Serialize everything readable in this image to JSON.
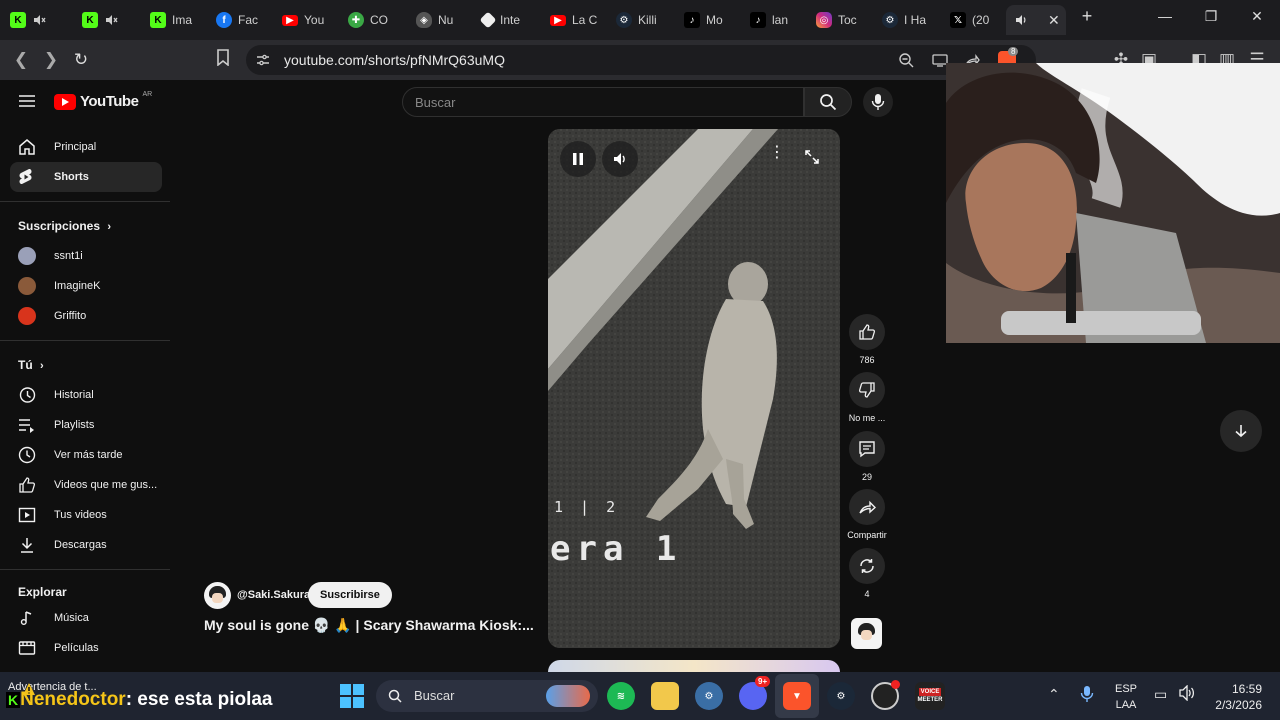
{
  "browser": {
    "tabs": [
      {
        "label": "",
        "icon": "kick-icon",
        "muted": true
      },
      {
        "label": "",
        "icon": "kick-icon",
        "muted": true
      },
      {
        "label": "Ima",
        "icon": "kick-icon"
      },
      {
        "label": "Fac",
        "icon": "facebook-icon"
      },
      {
        "label": "You",
        "icon": "youtube-icon"
      },
      {
        "label": "CO",
        "icon": "game-icon"
      },
      {
        "label": "Nu",
        "icon": "shield-icon"
      },
      {
        "label": "Inte",
        "icon": "diamond-icon"
      },
      {
        "label": "La C",
        "icon": "youtube-icon"
      },
      {
        "label": "Killi",
        "icon": "steam-icon"
      },
      {
        "label": "Mo",
        "icon": "tiktok-icon"
      },
      {
        "label": "lan",
        "icon": "tiktok-icon"
      },
      {
        "label": "Toc",
        "icon": "instagram-icon"
      },
      {
        "label": "I Ha",
        "icon": "steam-icon"
      },
      {
        "label": "(20",
        "icon": "x-icon"
      },
      {
        "label": "",
        "icon": "speaker-icon",
        "active": true
      }
    ],
    "url": "youtube.com/shorts/pfNMrQ63uMQ",
    "extension_badge": "8"
  },
  "youtube": {
    "logo_text": "YouTube",
    "country": "AR",
    "search_placeholder": "Buscar"
  },
  "sidebar": {
    "main": [
      {
        "label": "Principal",
        "icon": "home-icon"
      },
      {
        "label": "Shorts",
        "icon": "shorts-icon",
        "active": true
      }
    ],
    "subscriptions_title": "Suscripciones",
    "subscriptions": [
      {
        "label": "ssnt1i",
        "color": "#9aa0b8"
      },
      {
        "label": "ImagineK",
        "color": "#8a5a3a"
      },
      {
        "label": "Griffito",
        "color": "#d8341c"
      }
    ],
    "you_title": "Tú",
    "you_items": [
      {
        "label": "Historial",
        "icon": "history-icon"
      },
      {
        "label": "Playlists",
        "icon": "playlist-icon"
      },
      {
        "label": "Ver más tarde",
        "icon": "clock-icon"
      },
      {
        "label": "Videos que me gus...",
        "icon": "thumb-up-icon"
      },
      {
        "label": "Tus videos",
        "icon": "video-icon"
      },
      {
        "label": "Descargas",
        "icon": "download-icon"
      }
    ],
    "explore_title": "Explorar",
    "explore_items": [
      {
        "label": "Música",
        "icon": "music-icon"
      },
      {
        "label": "Películas",
        "icon": "film-icon"
      }
    ]
  },
  "short": {
    "overlay_counter": "1 | 2",
    "overlay_text": "era 1",
    "channel": "@Saki.Sakura",
    "subscribe_label": "Suscribirse",
    "title": "My soul is gone 💀 🙏 | Scary Shawarma Kiosk:...",
    "actions": {
      "likes": "786",
      "dislike_label": "No me ...",
      "comments": "29",
      "share_label": "Compartir",
      "remix": "4"
    }
  },
  "taskbar": {
    "notification_title": "Advertencia de t...",
    "chat_user": "Nenedoctor",
    "chat_message": ": ese esta piolaa",
    "search_placeholder": "Buscar",
    "discord_badge": "9+",
    "voicemeeter_label_1": "VOICE",
    "voicemeeter_label_2": "MEETER",
    "language": "ESP",
    "layout": "LAA",
    "time": "16:59",
    "date": "2/3/2026"
  }
}
